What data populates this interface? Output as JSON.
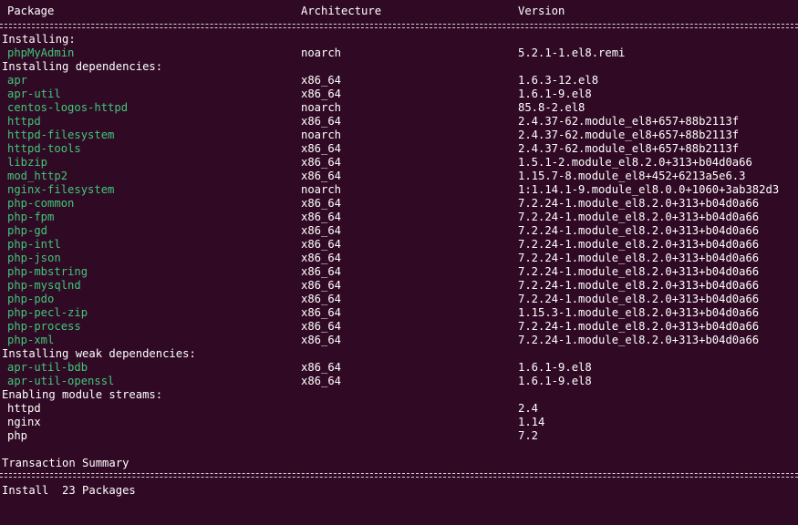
{
  "header": {
    "package": "Package",
    "architecture": "Architecture",
    "version": "Version"
  },
  "sections": {
    "installing": "Installing:",
    "installing_dependencies": "Installing dependencies:",
    "installing_weak": "Installing weak dependencies:",
    "enabling_module_streams": "Enabling module streams:"
  },
  "installing": [
    {
      "name": "phpMyAdmin",
      "arch": "noarch",
      "version": "5.2.1-1.el8.remi"
    }
  ],
  "dependencies": [
    {
      "name": "apr",
      "arch": "x86_64",
      "version": "1.6.3-12.el8"
    },
    {
      "name": "apr-util",
      "arch": "x86_64",
      "version": "1.6.1-9.el8"
    },
    {
      "name": "centos-logos-httpd",
      "arch": "noarch",
      "version": "85.8-2.el8"
    },
    {
      "name": "httpd",
      "arch": "x86_64",
      "version": "2.4.37-62.module_el8+657+88b2113f"
    },
    {
      "name": "httpd-filesystem",
      "arch": "noarch",
      "version": "2.4.37-62.module_el8+657+88b2113f"
    },
    {
      "name": "httpd-tools",
      "arch": "x86_64",
      "version": "2.4.37-62.module_el8+657+88b2113f"
    },
    {
      "name": "libzip",
      "arch": "x86_64",
      "version": "1.5.1-2.module_el8.2.0+313+b04d0a66"
    },
    {
      "name": "mod_http2",
      "arch": "x86_64",
      "version": "1.15.7-8.module_el8+452+6213a5e6.3"
    },
    {
      "name": "nginx-filesystem",
      "arch": "noarch",
      "version": "1:1.14.1-9.module_el8.0.0+1060+3ab382d3"
    },
    {
      "name": "php-common",
      "arch": "x86_64",
      "version": "7.2.24-1.module_el8.2.0+313+b04d0a66"
    },
    {
      "name": "php-fpm",
      "arch": "x86_64",
      "version": "7.2.24-1.module_el8.2.0+313+b04d0a66"
    },
    {
      "name": "php-gd",
      "arch": "x86_64",
      "version": "7.2.24-1.module_el8.2.0+313+b04d0a66"
    },
    {
      "name": "php-intl",
      "arch": "x86_64",
      "version": "7.2.24-1.module_el8.2.0+313+b04d0a66"
    },
    {
      "name": "php-json",
      "arch": "x86_64",
      "version": "7.2.24-1.module_el8.2.0+313+b04d0a66"
    },
    {
      "name": "php-mbstring",
      "arch": "x86_64",
      "version": "7.2.24-1.module_el8.2.0+313+b04d0a66"
    },
    {
      "name": "php-mysqlnd",
      "arch": "x86_64",
      "version": "7.2.24-1.module_el8.2.0+313+b04d0a66"
    },
    {
      "name": "php-pdo",
      "arch": "x86_64",
      "version": "7.2.24-1.module_el8.2.0+313+b04d0a66"
    },
    {
      "name": "php-pecl-zip",
      "arch": "x86_64",
      "version": "1.15.3-1.module_el8.2.0+313+b04d0a66"
    },
    {
      "name": "php-process",
      "arch": "x86_64",
      "version": "7.2.24-1.module_el8.2.0+313+b04d0a66"
    },
    {
      "name": "php-xml",
      "arch": "x86_64",
      "version": "7.2.24-1.module_el8.2.0+313+b04d0a66"
    }
  ],
  "weak_dependencies": [
    {
      "name": "apr-util-bdb",
      "arch": "x86_64",
      "version": "1.6.1-9.el8"
    },
    {
      "name": "apr-util-openssl",
      "arch": "x86_64",
      "version": "1.6.1-9.el8"
    }
  ],
  "module_streams": [
    {
      "name": "httpd",
      "version": "2.4"
    },
    {
      "name": "nginx",
      "version": "1.14"
    },
    {
      "name": "php",
      "version": "7.2"
    }
  ],
  "summary": {
    "title": "Transaction Summary",
    "install_line": "Install  23 Packages"
  },
  "colors": {
    "background": "#300a24",
    "text": "#ffffff",
    "package_name": "#3fc77a"
  }
}
